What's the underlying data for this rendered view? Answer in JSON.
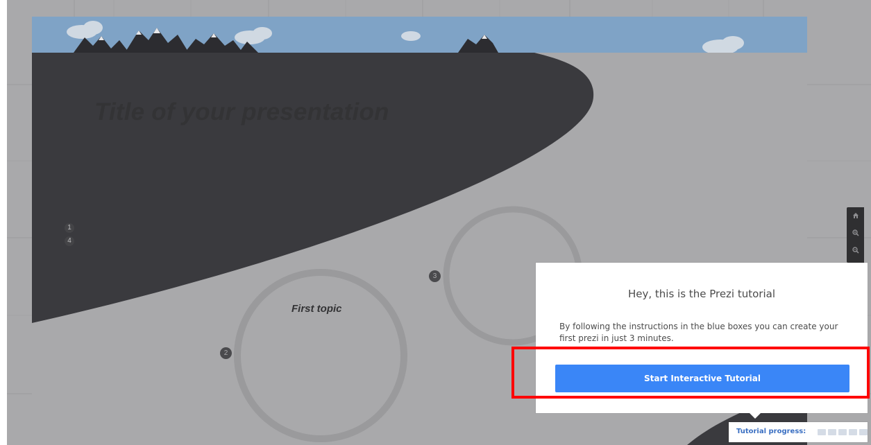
{
  "presentation": {
    "title": "Title of your presentation",
    "topics": [
      {
        "title": "First topic"
      }
    ],
    "path_badges": [
      "2",
      "3"
    ],
    "path_numbers": [
      "1",
      "4"
    ]
  },
  "zoom_controls": {
    "home_icon": "home-icon",
    "zoom_in_icon": "zoom-in-icon",
    "zoom_out_icon": "zoom-out-icon"
  },
  "tutorial": {
    "heading": "Hey, this is the Prezi tutorial",
    "body": "By following the instructions in the blue boxes you can create your first prezi in just 3 minutes.",
    "start_button_label": "Start Interactive Tutorial",
    "progress_label": "Tutorial progress:",
    "progress_steps_total": 5,
    "progress_steps_completed": 0
  },
  "colors": {
    "accent": "#3a86f7",
    "slide_dark": "#3a3a3e",
    "canvas_grey": "#a9a9ab",
    "sky": "#7fa3c6",
    "highlight": "#ff0000"
  }
}
